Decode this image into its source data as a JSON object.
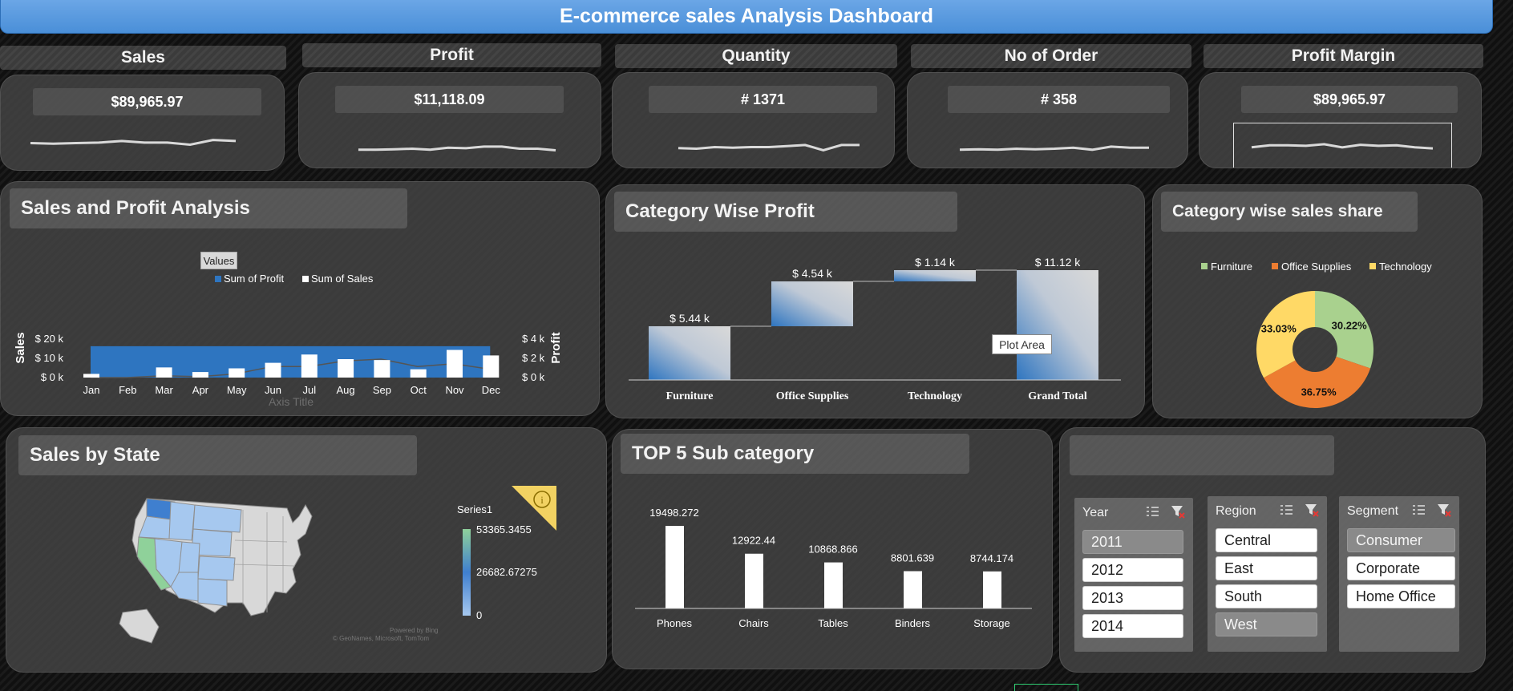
{
  "dashboard": {
    "title": "E-commerce sales Analysis Dashboard"
  },
  "kpis": [
    {
      "label": "Sales",
      "value": "$89,965.97"
    },
    {
      "label": "Profit",
      "value": "$11,118.09"
    },
    {
      "label": "Quantity",
      "value": "# 1371"
    },
    {
      "label": "No of Order",
      "value": "# 358"
    },
    {
      "label": "Profit Margin",
      "value": "$89,965.97"
    }
  ],
  "sales_profit": {
    "title": "Sales and Profit Analysis",
    "values_button": "Values",
    "axis_title": "Axis Title",
    "colors": {
      "profit": "#2e75c0",
      "sales": "#ffffff"
    }
  },
  "category_profit": {
    "title": "Category Wise Profit",
    "plot_area_tooltip": "Plot Area"
  },
  "category_share": {
    "title": "Category wise sales share"
  },
  "state_map": {
    "title": "Sales by State",
    "legend_title": "Series1",
    "legend_values": [
      "53365.3455",
      "26682.67275",
      "0"
    ],
    "attribution": [
      "Powered by Bing",
      "© GeoNames, Microsoft, TomTom"
    ],
    "info_icon": "info-icon"
  },
  "top5": {
    "title": "TOP 5 Sub category"
  },
  "slicers": {
    "year": {
      "label": "Year",
      "items": [
        "2011",
        "2012",
        "2013",
        "2014"
      ],
      "selected": "2011"
    },
    "region": {
      "label": "Region",
      "items": [
        "Central",
        "East",
        "South",
        "West"
      ],
      "selected": "West"
    },
    "segment": {
      "label": "Segment",
      "items": [
        "Consumer",
        "Corporate",
        "Home Office"
      ],
      "selected": "Consumer"
    }
  },
  "chart_data": [
    {
      "type": "bar",
      "name": "Sales and Profit Analysis",
      "categories": [
        "Jan",
        "Feb",
        "Mar",
        "Apr",
        "May",
        "Jun",
        "Jul",
        "Aug",
        "Sep",
        "Oct",
        "Nov",
        "Dec"
      ],
      "series": [
        {
          "name": "Sum of Profit",
          "type": "area",
          "axis": "secondary",
          "values": [
            3400,
            3400,
            3400,
            3400,
            3400,
            3400,
            3400,
            3400,
            3400,
            3400,
            3400,
            3400
          ]
        },
        {
          "name": "Sum of Sales",
          "type": "bar",
          "axis": "primary",
          "values": [
            2000,
            0,
            5500,
            3000,
            5000,
            8000,
            12500,
            10000,
            9500,
            4500,
            15000,
            12000
          ]
        }
      ],
      "overlay_line": [
        0,
        0,
        200,
        100,
        400,
        1200,
        1200,
        1800,
        2000,
        1200,
        1500,
        900
      ],
      "ylabel": "Sales",
      "y2label": "Profit",
      "xlabel": "Axis Title",
      "y_ticks": [
        "$ 0 k",
        "$ 10 k",
        "$ 20 k"
      ],
      "ylim": [
        0,
        20000
      ],
      "y2_ticks": [
        "$ 0 k",
        "$ 2 k",
        "$ 4 k"
      ],
      "y2lim": [
        0,
        4000
      ],
      "legend": "top"
    },
    {
      "type": "waterfall",
      "name": "Category Wise Profit",
      "categories": [
        "Furniture",
        "Office Supplies",
        "Technology",
        "Grand Total"
      ],
      "values": [
        5.44,
        4.54,
        1.14,
        11.12
      ],
      "labels": [
        "$ 5.44 k",
        "$ 4.54 k",
        "$ 1.14 k",
        "$ 11.12 k"
      ]
    },
    {
      "type": "pie",
      "name": "Category wise sales share",
      "labels": [
        "Furniture",
        "Office Supplies",
        "Technology"
      ],
      "values": [
        30.22,
        36.75,
        33.03
      ],
      "value_labels": [
        "30.22%",
        "36.75%",
        "33.03%"
      ],
      "colors": [
        "#a9d18e",
        "#ed7d31",
        "#ffd966"
      ],
      "legend": "top"
    },
    {
      "type": "bar",
      "name": "TOP 5 Sub category",
      "categories": [
        "Phones",
        "Chairs",
        "Tables",
        "Binders",
        "Storage"
      ],
      "values": [
        19498.272,
        12922.44,
        10868.866,
        8801.639,
        8744.174
      ],
      "value_labels": [
        "19498.272",
        "12922.44",
        "10868.866",
        "8801.639",
        "8744.174"
      ]
    }
  ],
  "sparklines": [
    [
      0.5,
      0.55,
      0.5,
      0.45,
      0.3,
      0.45,
      0.45,
      0.65,
      0.2,
      0.3
    ],
    [
      0.6,
      0.6,
      0.55,
      0.5,
      0.6,
      0.4,
      0.45,
      0.3,
      0.3,
      0.5,
      0.5,
      0.65
    ],
    [
      0.6,
      0.65,
      0.5,
      0.55,
      0.5,
      0.5,
      0.4,
      0.3,
      0.8,
      0.3,
      0.3
    ],
    [
      0.6,
      0.55,
      0.6,
      0.5,
      0.55,
      0.5,
      0.4,
      0.6,
      0.3,
      0.4,
      0.4
    ],
    [
      0.6,
      0.4,
      0.4,
      0.45,
      0.3,
      0.6,
      0.35,
      0.45,
      0.4,
      0.6,
      0.7
    ]
  ]
}
